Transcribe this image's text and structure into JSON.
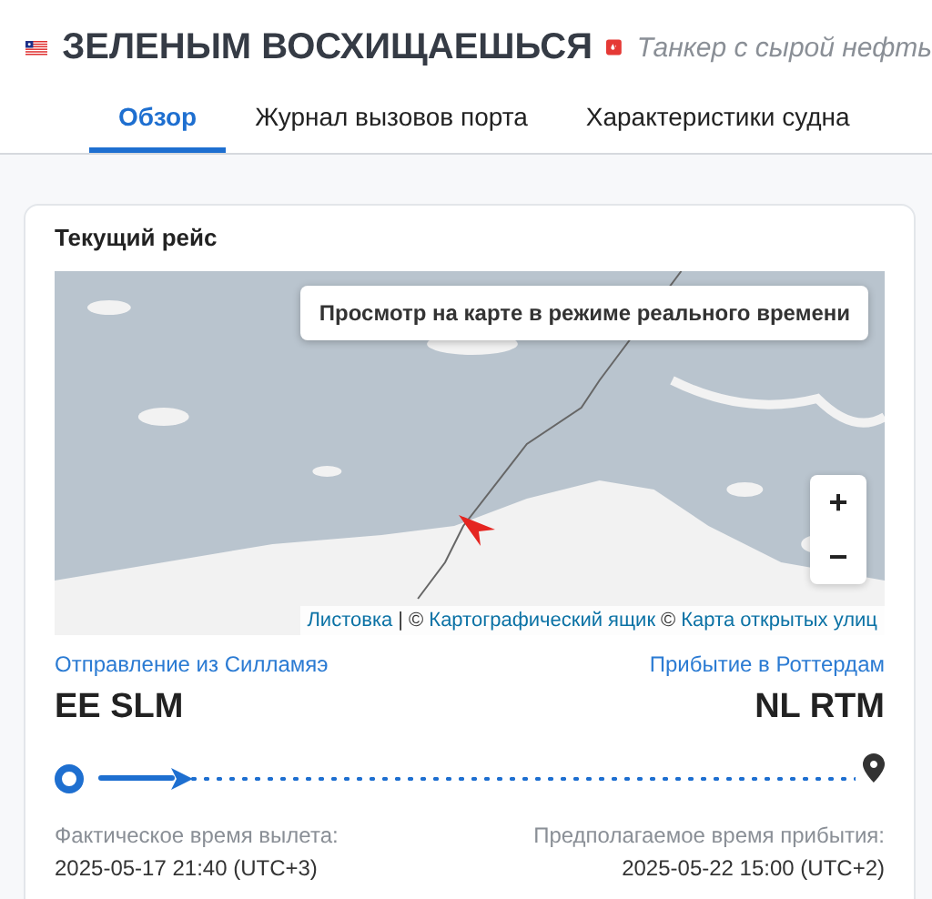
{
  "vessel": {
    "name": "ЗЕЛЕНЫМ ВОСХИЩАЕШЬСЯ",
    "type": "Танкер с сырой нефть"
  },
  "tabs": [
    {
      "label": "Обзор",
      "selected": true
    },
    {
      "label": "Журнал вызовов порта",
      "selected": false
    },
    {
      "label": "Характеристики судна",
      "selected": false
    }
  ],
  "voyage": {
    "title": "Текущий рейс",
    "map": {
      "kind": "picture",
      "live_view_button": "Просмотр на карте в режиме реального времени",
      "zoom_in": "+",
      "zoom_out": "−",
      "attribution": [
        {
          "kind": "link",
          "text": "Листовка"
        },
        {
          "kind": "text",
          "text": "| ©"
        },
        {
          "kind": "link",
          "text": "Картографический ящик"
        },
        {
          "kind": "text",
          "text": "©"
        },
        {
          "kind": "link",
          "text": "Карта открытых улиц"
        }
      ]
    },
    "departure": {
      "label": "Отправление из Силламяэ",
      "code": "EE SLM",
      "time_label": "Фактическое время вылета:",
      "time": "2025-05-17 21:40 (UTC+3)"
    },
    "arrival": {
      "label": "Прибытие в Роттердам",
      "code": "NL RTM",
      "time_label": "Предполагаемое время прибытия:",
      "time": "2025-05-22 15:00 (UTC+2)"
    },
    "progress": {
      "level": 0.1
    }
  }
}
